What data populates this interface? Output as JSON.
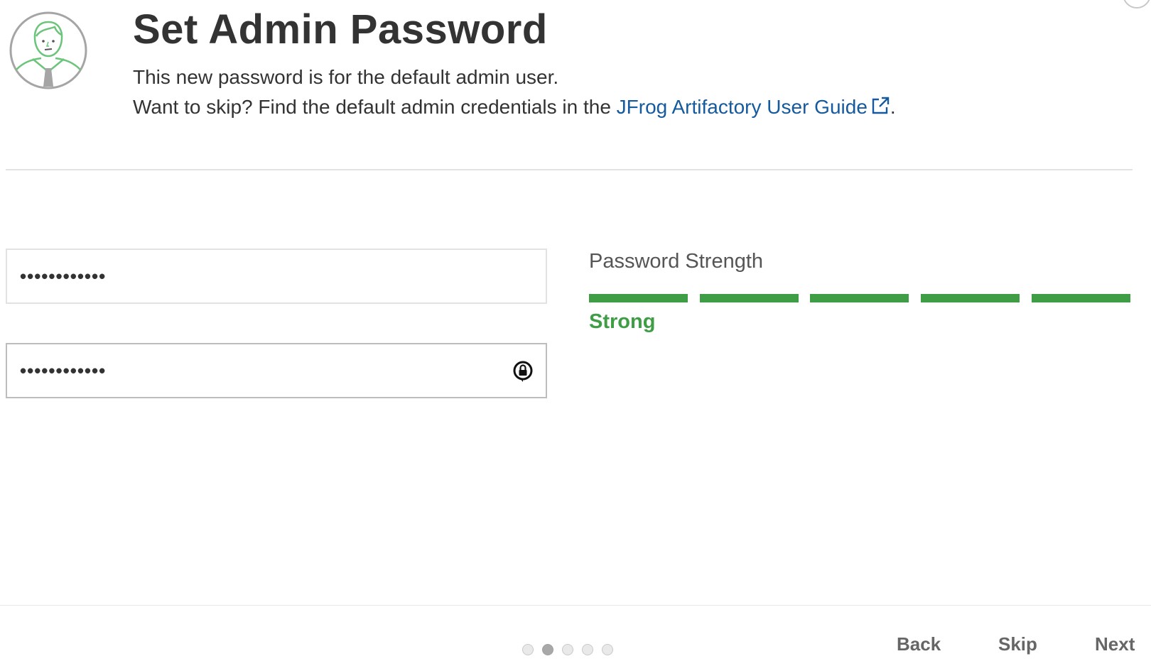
{
  "header": {
    "title": "Set Admin Password",
    "subtitle_line1": "This new password is for the default admin user.",
    "subtitle_line2_prefix": "Want to skip? Find the default admin credentials in the ",
    "guide_link_label": "JFrog Artifactory User Guide",
    "subtitle_line2_suffix": ".",
    "avatar_icon": "admin-user-avatar-icon",
    "link_icon": "external-link-icon"
  },
  "form": {
    "password_masked": "••••••••••••",
    "confirm_password_masked": "••••••••••••",
    "confirm_toggle_icon": "password-manager-icon"
  },
  "strength": {
    "label": "Password Strength",
    "value": "Strong",
    "level_filled": 5,
    "level_total": 5,
    "color": "#3f9e45"
  },
  "footer": {
    "steps_total": 5,
    "current_step": 2,
    "back_label": "Back",
    "skip_label": "Skip",
    "next_label": "Next"
  },
  "colors": {
    "link": "#155a9e",
    "text": "#333333",
    "avatar_green": "#6cc47a",
    "avatar_gray": "#a5a5a5"
  }
}
